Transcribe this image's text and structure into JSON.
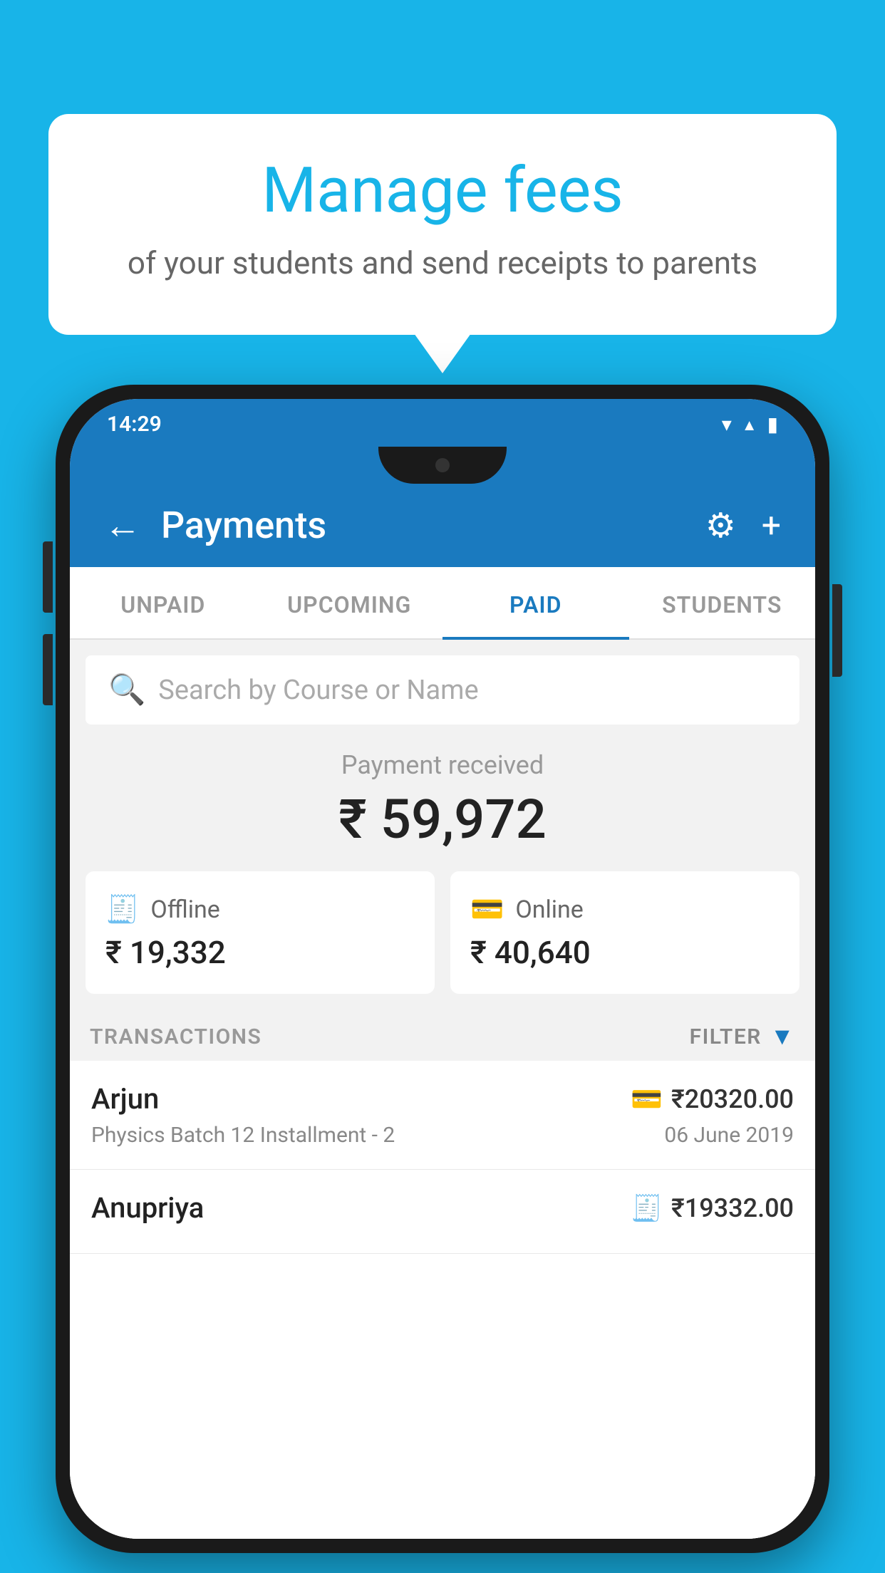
{
  "background_color": "#18b4e8",
  "speech_bubble": {
    "title": "Manage fees",
    "subtitle": "of your students and send receipts to parents"
  },
  "status_bar": {
    "time": "14:29",
    "icons": [
      "wifi",
      "signal",
      "battery"
    ]
  },
  "header": {
    "title": "Payments",
    "back_label": "←",
    "settings_label": "⚙",
    "add_label": "+"
  },
  "tabs": [
    {
      "label": "UNPAID",
      "active": false
    },
    {
      "label": "UPCOMING",
      "active": false
    },
    {
      "label": "PAID",
      "active": true
    },
    {
      "label": "STUDENTS",
      "active": false
    }
  ],
  "search": {
    "placeholder": "Search by Course or Name"
  },
  "payment_received": {
    "label": "Payment received",
    "amount": "₹ 59,972"
  },
  "payment_methods": [
    {
      "icon": "💳",
      "label": "Offline",
      "amount": "₹ 19,332"
    },
    {
      "icon": "💳",
      "label": "Online",
      "amount": "₹ 40,640"
    }
  ],
  "transactions_section": {
    "label": "TRANSACTIONS",
    "filter_label": "FILTER"
  },
  "transactions": [
    {
      "name": "Arjun",
      "course": "Physics Batch 12 Installment - 2",
      "amount": "₹20320.00",
      "date": "06 June 2019",
      "method_icon": "💳"
    },
    {
      "name": "Anupriya",
      "course": "",
      "amount": "₹19332.00",
      "date": "",
      "method_icon": "💴"
    }
  ]
}
